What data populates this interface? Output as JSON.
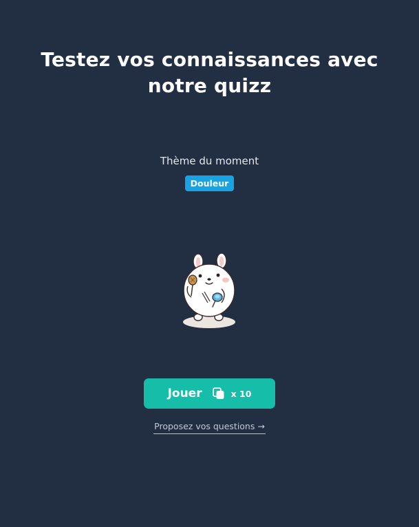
{
  "title": "Testez vos connaissances avec notre quizz",
  "theme": {
    "label": "Thème du moment",
    "badge": "Douleur",
    "badge_color": "#1aa3e3"
  },
  "mascot": {
    "icon": "bunny-mascot-icon"
  },
  "play": {
    "label": "Jouer",
    "icon": "cards-stack-icon",
    "count": "x 10",
    "color": "#16bda9"
  },
  "propose": {
    "label": "Proposez vos questions →"
  },
  "colors": {
    "background": "#222e42",
    "accent": "#16bda9"
  }
}
